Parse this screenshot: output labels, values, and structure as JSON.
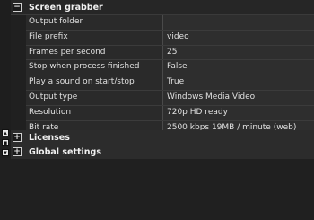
{
  "sections": {
    "screen_grabber": {
      "title": "Screen grabber",
      "toggle": "−"
    },
    "licenses": {
      "title": "Licenses",
      "toggle": "+"
    },
    "global_settings": {
      "title": "Global settings",
      "toggle": "+"
    }
  },
  "properties": [
    {
      "name": "Output folder",
      "value": ""
    },
    {
      "name": "File prefix",
      "value": "video"
    },
    {
      "name": "Frames per second",
      "value": "25"
    },
    {
      "name": "Stop when process finished",
      "value": "False"
    },
    {
      "name": "Play a sound on start/stop",
      "value": "True"
    },
    {
      "name": "Output type",
      "value": "Windows Media Video"
    },
    {
      "name": "Resolution",
      "value": "720p HD ready"
    },
    {
      "name": "Bit rate",
      "value": "2500 kbps 19MB / minute (web)"
    }
  ],
  "strip_buttons": [
    {
      "icon": "scroll-up-icon"
    },
    {
      "icon": "scroll-middle-icon"
    },
    {
      "icon": "scroll-down-icon"
    }
  ]
}
